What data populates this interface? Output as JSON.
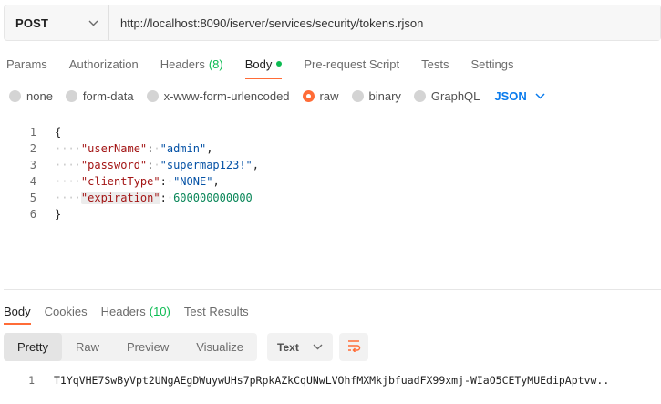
{
  "request": {
    "method": "POST",
    "url": "http://localhost:8090/iserver/services/security/tokens.rjson"
  },
  "request_tabs": [
    {
      "label": "Params",
      "count": ""
    },
    {
      "label": "Authorization",
      "count": ""
    },
    {
      "label": "Headers",
      "count": "(8)"
    },
    {
      "label": "Body",
      "count": ""
    },
    {
      "label": "Pre-request Script",
      "count": ""
    },
    {
      "label": "Tests",
      "count": ""
    },
    {
      "label": "Settings",
      "count": ""
    }
  ],
  "body_options": {
    "none": "none",
    "form_data": "form-data",
    "urlencoded": "x-www-form-urlencoded",
    "raw": "raw",
    "binary": "binary",
    "graphql": "GraphQL",
    "selected": "raw",
    "language": "JSON"
  },
  "editor": {
    "line_numbers": [
      "1",
      "2",
      "3",
      "4",
      "5",
      "6"
    ],
    "open_brace": "{",
    "close_brace": "}",
    "fields": [
      {
        "key": "\"userName\"",
        "value": "\"admin\"",
        "comma": ","
      },
      {
        "key": "\"password\"",
        "value": "\"supermap123!\"",
        "comma": ","
      },
      {
        "key": "\"clientType\"",
        "value": "\"NONE\"",
        "comma": ","
      },
      {
        "key": "\"expiration\"",
        "value": "600000000000",
        "comma": ""
      }
    ],
    "indent_dots": "····",
    "colon": ":",
    "space_dot": "·"
  },
  "response_tabs": [
    {
      "label": "Body",
      "count": ""
    },
    {
      "label": "Cookies",
      "count": ""
    },
    {
      "label": "Headers",
      "count": "(10)"
    },
    {
      "label": "Test Results",
      "count": ""
    }
  ],
  "response_toolbar": {
    "views": [
      "Pretty",
      "Raw",
      "Preview",
      "Visualize"
    ],
    "active_view": "Pretty",
    "format": "Text"
  },
  "response_body": {
    "line_number": "1",
    "text": "T1YqVHE7SwByVpt2UNgAEgDWuywUHs7pRpkAZkCqUNwLVOhfMXMkjbfuadFX99xmj-WIaO5CETyMUEdipAptvw.."
  },
  "colors": {
    "accent": "#ff6c37",
    "indicator": "#0cbb52",
    "language": "#097bed"
  }
}
